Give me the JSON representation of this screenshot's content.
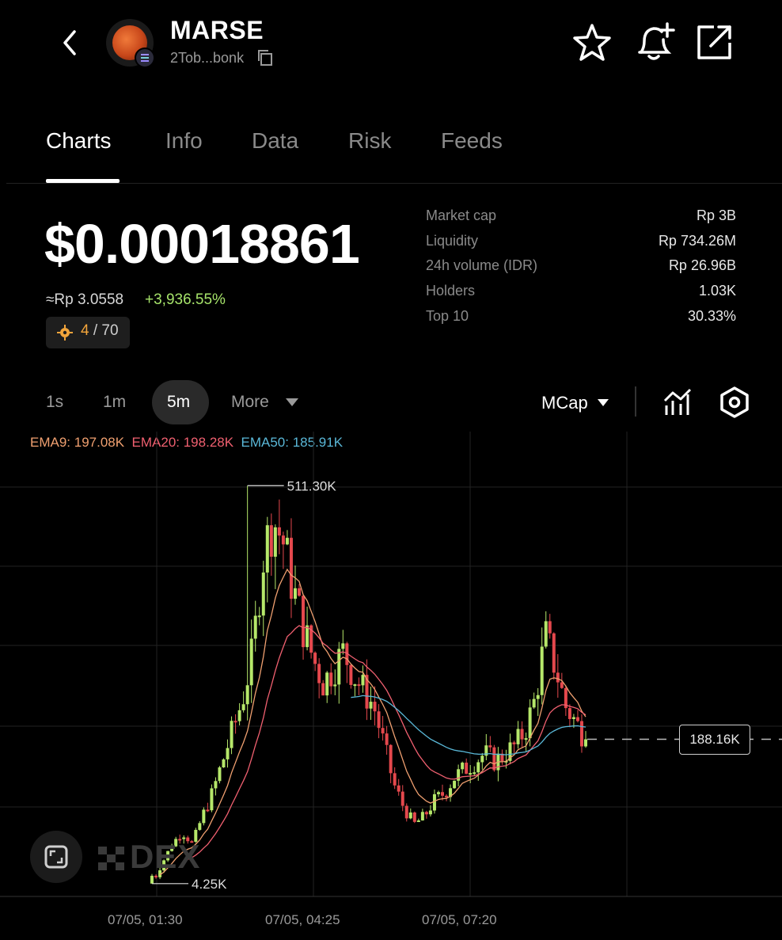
{
  "header": {
    "token_name": "MARSE",
    "token_address": "2Tob...bonk",
    "icons": [
      "back-icon",
      "star-icon",
      "bell-plus-icon",
      "share-icon",
      "copy-icon"
    ]
  },
  "tabs": [
    {
      "label": "Charts",
      "active": true
    },
    {
      "label": "Info",
      "active": false
    },
    {
      "label": "Data",
      "active": false
    },
    {
      "label": "Risk",
      "active": false
    },
    {
      "label": "Feeds",
      "active": false
    }
  ],
  "price": {
    "usd": "$0.00018861",
    "rp": "≈Rp 3.0558",
    "change": "+3,936.55%",
    "score": "4",
    "score_total": "/ 70"
  },
  "stats": [
    {
      "label": "Market cap",
      "value": "Rp 3B"
    },
    {
      "label": "Liquidity",
      "value": "Rp 734.26M"
    },
    {
      "label": "24h volume (IDR)",
      "value": "Rp 26.96B"
    },
    {
      "label": "Holders",
      "value": "1.03K"
    },
    {
      "label": "Top 10",
      "value": "30.33%"
    }
  ],
  "intervals": {
    "items": [
      "1s",
      "1m",
      "5m"
    ],
    "selected": "5m",
    "more_label": "More",
    "metric_label": "MCap"
  },
  "ema": {
    "ema9": "EMA9: 197.08K",
    "ema20": "EMA20: 198.28K",
    "ema50": "EMA50: 185.91K"
  },
  "colors": {
    "up": "#b6e86a",
    "down": "#e5484d",
    "ema9": "#f0a070",
    "ema20": "#f06070",
    "ema50": "#5ab8d8",
    "accent_change": "#a6e36a"
  },
  "watermark": "DEX",
  "chart_data": {
    "type": "candlestick",
    "x_labels": [
      "07/05, 01:30",
      "07/05, 04:25",
      "07/05, 07:20"
    ],
    "high_label": "511.30K",
    "low_label": "4.25K",
    "current_label": "188.16K",
    "high": 511.3,
    "low": 4.25,
    "current": 188.16,
    "unit": "K",
    "ylim": [
      0,
      560
    ],
    "close_profile": [
      4.25,
      30,
      55,
      70,
      55,
      90,
      120,
      160,
      200,
      240,
      300,
      420,
      470,
      440,
      380,
      330,
      290,
      260,
      280,
      300,
      270,
      250,
      230,
      180,
      130,
      100,
      80,
      90,
      110,
      120,
      140,
      150,
      160,
      170,
      160,
      170,
      180,
      200,
      240,
      320,
      280,
      230,
      210,
      188.16
    ]
  }
}
